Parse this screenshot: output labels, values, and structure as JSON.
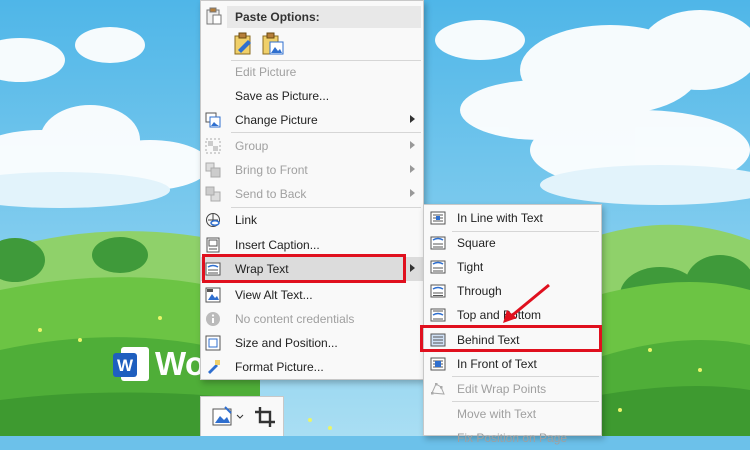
{
  "context_menu": {
    "paste_options_label": "Paste Options:",
    "items": [
      {
        "label": "Edit Picture",
        "enabled": false,
        "submenu": false,
        "icon": "none"
      },
      {
        "label": "Save as Picture...",
        "enabled": true,
        "submenu": false,
        "icon": "none"
      },
      {
        "label": "Change Picture",
        "enabled": true,
        "submenu": true,
        "icon": "change-picture-icon"
      },
      {
        "label": "Group",
        "enabled": false,
        "submenu": true,
        "icon": "group-icon"
      },
      {
        "label": "Bring to Front",
        "enabled": false,
        "submenu": true,
        "icon": "bring-to-front-icon"
      },
      {
        "label": "Send to Back",
        "enabled": false,
        "submenu": true,
        "icon": "send-to-back-icon"
      },
      {
        "label": "Link",
        "enabled": true,
        "submenu": false,
        "icon": "link-icon"
      },
      {
        "label": "Insert Caption...",
        "enabled": true,
        "submenu": false,
        "icon": "insert-caption-icon"
      },
      {
        "label": "Wrap Text",
        "enabled": true,
        "submenu": true,
        "icon": "wrap-text-icon",
        "highlighted": true
      },
      {
        "label": "View Alt Text...",
        "enabled": true,
        "submenu": false,
        "icon": "alt-text-icon"
      },
      {
        "label": "No content credentials",
        "enabled": false,
        "submenu": false,
        "icon": "info-icon"
      },
      {
        "label": "Size and Position...",
        "enabled": true,
        "submenu": false,
        "icon": "size-position-icon"
      },
      {
        "label": "Format Picture...",
        "enabled": true,
        "submenu": false,
        "icon": "format-picture-icon"
      }
    ]
  },
  "wrap_submenu": {
    "items": [
      {
        "label": "In Line with Text",
        "enabled": true
      },
      {
        "label": "Square",
        "enabled": true
      },
      {
        "label": "Tight",
        "enabled": true
      },
      {
        "label": "Through",
        "enabled": true
      },
      {
        "label": "Top and Bottom",
        "enabled": true
      },
      {
        "label": "Behind Text",
        "enabled": true,
        "highlighted": true
      },
      {
        "label": "In Front of Text",
        "enabled": true
      },
      {
        "label": "Edit Wrap Points",
        "enabled": false
      },
      {
        "label": "Move with Text",
        "enabled": false
      },
      {
        "label": "Fix Position on Page",
        "enabled": false
      }
    ]
  },
  "watermark": {
    "brand": "Word.com.vn"
  },
  "colors": {
    "highlight_border": "#e0101e",
    "menu_bg": "#f9f9f9",
    "sky": "#6cc1ea",
    "grass": "#5fb33a"
  }
}
